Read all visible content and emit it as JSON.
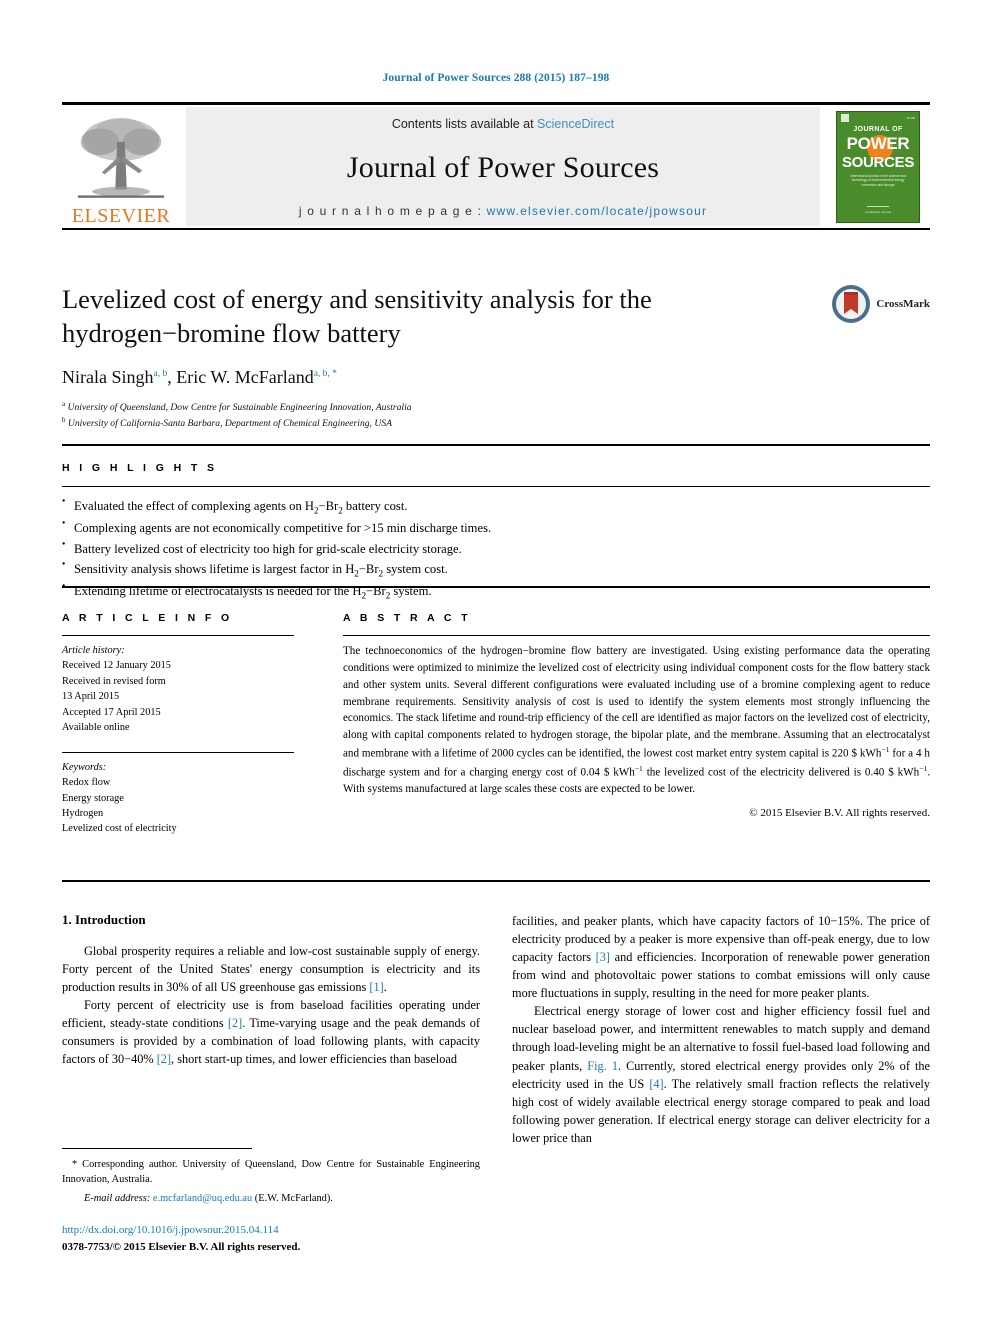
{
  "running_head": "Journal of Power Sources 288 (2015) 187–198",
  "masthead": {
    "contents_prefix": "Contents lists available at ",
    "sciencedirect": "ScienceDirect",
    "journal_title": "Journal of Power Sources",
    "homepage_prefix": "j o u r n a l  h o m e p a g e :  ",
    "homepage_url": "www.elsevier.com/locate/jpowsour",
    "publisher": "ELSEVIER",
    "cover": {
      "journal_of": "JOURNAL OF",
      "power": "POWER",
      "sources": "SOURCES",
      "subtitle": "International journal on the science and technology of electrochemical energy conversion and storage",
      "footer": "An Elsevier Journal"
    }
  },
  "article": {
    "title": "Levelized cost of energy and sensitivity analysis for the hydrogen−bromine flow battery",
    "authors": [
      {
        "name": "Nirala Singh",
        "marks": "a, b",
        "sep": ", "
      },
      {
        "name": "Eric W. McFarland",
        "marks": "a, b, *",
        "sep": ""
      }
    ],
    "affiliations": [
      {
        "mark": "a",
        "text": "University of Queensland, Dow Centre for Sustainable Engineering Innovation, Australia"
      },
      {
        "mark": "b",
        "text": "University of California-Santa Barbara, Department of Chemical Engineering, USA"
      }
    ],
    "crossmark_label": "CrossMark"
  },
  "highlights": {
    "label": "H I G H L I G H T S",
    "items": [
      "Evaluated the effect of complexing agents on H2−Br2 battery cost.",
      "Complexing agents are not economically competitive for >15 min discharge times.",
      "Battery levelized cost of electricity too high for grid-scale electricity storage.",
      "Sensitivity analysis shows lifetime is largest factor in H2−Br2 system cost.",
      "Extending lifetime of electrocatalysts is needed for the H2−Br2 system."
    ]
  },
  "article_info": {
    "label": "A R T I C L E   I N F O",
    "history_label": "Article history:",
    "history": [
      "Received 12 January 2015",
      "Received in revised form",
      "13 April 2015",
      "Accepted 17 April 2015",
      "Available online"
    ],
    "keywords_label": "Keywords:",
    "keywords": [
      "Redox flow",
      "Energy storage",
      "Hydrogen",
      "Levelized cost of electricity"
    ]
  },
  "abstract": {
    "label": "A B S T R A C T",
    "text": "The technoeconomics of the hydrogen−bromine flow battery are investigated. Using existing performance data the operating conditions were optimized to minimize the levelized cost of electricity using individual component costs for the flow battery stack and other system units. Several different configurations were evaluated including use of a bromine complexing agent to reduce membrane requirements. Sensitivity analysis of cost is used to identify the system elements most strongly influencing the economics. The stack lifetime and round-trip efficiency of the cell are identified as major factors on the levelized cost of electricity, along with capital components related to hydrogen storage, the bipolar plate, and the membrane. Assuming that an electrocatalyst and membrane with a lifetime of 2000 cycles can be identified, the lowest cost market entry system capital is 220 $ kWh−1 for a 4 h discharge system and for a charging energy cost of 0.04 $ kWh−1 the levelized cost of the electricity delivered is 0.40 $ kWh−1. With systems manufactured at large scales these costs are expected to be lower.",
    "copyright": "© 2015 Elsevier B.V. All rights reserved."
  },
  "body": {
    "section_heading": "1. Introduction",
    "left_paragraphs": [
      "Global prosperity requires a reliable and low-cost sustainable supply of energy. Forty percent of the United States' energy consumption is electricity and its production results in 30% of all US greenhouse gas emissions [1].",
      "Forty percent of electricity use is from baseload facilities operating under efficient, steady-state conditions [2]. Time-varying usage and the peak demands of consumers is provided by a combination of load following plants, with capacity factors of 30−40% [2], short start-up times, and lower efficiencies than baseload"
    ],
    "right_paragraphs": [
      "facilities, and peaker plants, which have capacity factors of 10−15%. The price of electricity produced by a peaker is more expensive than off-peak energy, due to low capacity factors [3] and efficiencies. Incorporation of renewable power generation from wind and photovoltaic power stations to combat emissions will only cause more fluctuations in supply, resulting in the need for more peaker plants.",
      "Electrical energy storage of lower cost and higher efficiency fossil fuel and nuclear baseload power, and intermittent renewables to match supply and demand through load-leveling might be an alternative to fossil fuel-based load following and peaker plants, Fig. 1. Currently, stored electrical energy provides only 2% of the electricity used in the US [4]. The relatively small fraction reflects the relatively high cost of widely available electrical energy storage compared to peak and load following power generation. If electrical energy storage can deliver electricity for a lower price than"
    ]
  },
  "footnotes": {
    "corresponding": "* Corresponding author. University of Queensland, Dow Centre for Sustainable Engineering Innovation, Australia.",
    "email_label": "E-mail address:",
    "email": "e.mcfarland@uq.edu.au",
    "email_suffix": "(E.W. McFarland).",
    "doi": "http://dx.doi.org/10.1016/j.jpowsour.2015.04.114",
    "issn": "0378-7753/© 2015 Elsevier B.V. All rights reserved."
  },
  "colors": {
    "link_blue": "#1a7bb0",
    "sciencedirect_blue": "#3e8fc6",
    "elsevier_orange": "#e87722",
    "cover_green": "#4a8b2c"
  }
}
